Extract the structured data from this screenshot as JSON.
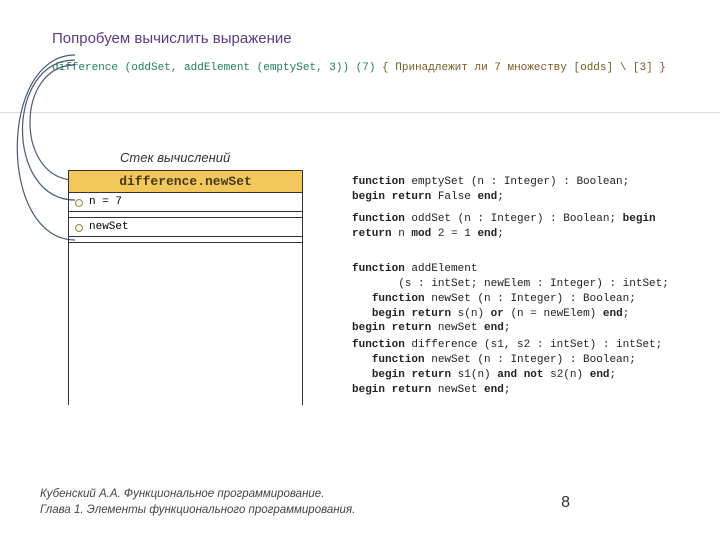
{
  "title": "Попробуем вычислить выражение",
  "expression": {
    "call": "difference (oddSet, addElement (emptySet, 3)) (7)",
    "comment": "  { Принадлежит ли 7 множеству [odds] \\ [3] }"
  },
  "stack": {
    "label": "Стек вычислений",
    "top_frame": "difference.newSet",
    "rows": [
      {
        "text": "n = 7",
        "dot": true
      },
      {
        "text": "",
        "gap": true
      },
      {
        "text": "newSet",
        "dot": true
      },
      {
        "text": "",
        "gap": true
      }
    ]
  },
  "code": {
    "emptySet": "function emptySet (n : Integer) : Boolean;\nbegin return False end;",
    "oddSet": "function oddSet (n : Integer) : Boolean; begin\nreturn n mod 2 = 1 end;",
    "addElement": "function addElement\n       (s : intSet; newElem : Integer) : intSet;\n   function newSet (n : Integer) : Boolean;\n   begin return s(n) or (n = newElem) end;\nbegin return newSet end;",
    "difference": "function difference (s1, s2 : intSet) : intSet;\n   function newSet (n : Integer) : Boolean;\n   begin return s1(n) and not s2(n) end;\nbegin return newSet end;"
  },
  "footer": {
    "line1": "Кубенский А.А. Функциональное программирование.",
    "line2": "Глава 1. Элементы функционального программирования."
  },
  "page": "8"
}
